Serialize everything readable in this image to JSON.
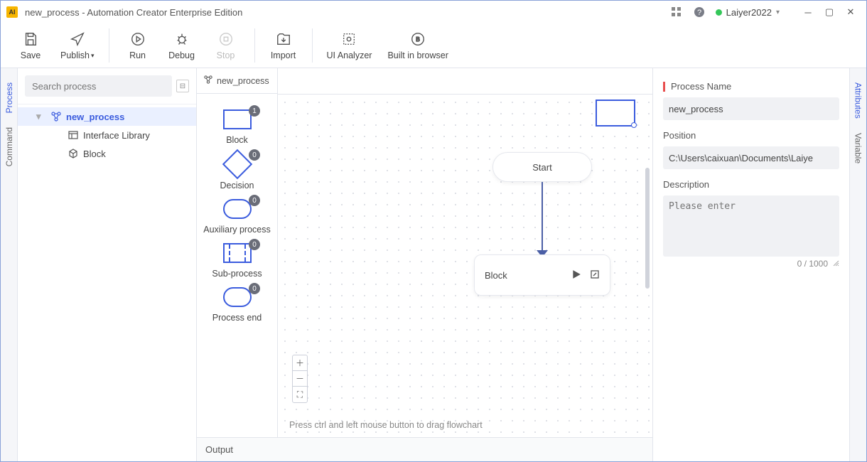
{
  "titlebar": {
    "title": "new_process - Automation Creator Enterprise Edition",
    "username": "Laiyer2022"
  },
  "toolbar": {
    "save": "Save",
    "publish": "Publish",
    "run": "Run",
    "debug": "Debug",
    "stop": "Stop",
    "import": "Import",
    "ui_analyzer": "UI Analyzer",
    "built_in_browser": "Built in browser"
  },
  "side_tabs_left": {
    "process": "Process",
    "command": "Command"
  },
  "side_tabs_right": {
    "attributes": "Attributes",
    "variable": "Variable"
  },
  "left_panel": {
    "search_placeholder": "Search process",
    "tree": {
      "root": "new_process",
      "children": [
        {
          "icon": "interface-library-icon",
          "label": "Interface Library"
        },
        {
          "icon": "block-icon",
          "label": "Block"
        }
      ]
    }
  },
  "palette": {
    "header": "new_process",
    "items": [
      {
        "label": "Block",
        "badge": "1",
        "shape": "block"
      },
      {
        "label": "Decision",
        "badge": "0",
        "shape": "decision"
      },
      {
        "label": "Auxiliary process",
        "badge": "0",
        "shape": "aux"
      },
      {
        "label": "Sub-process",
        "badge": "0",
        "shape": "sub"
      },
      {
        "label": "Process end",
        "badge": "0",
        "shape": "end"
      }
    ]
  },
  "canvas": {
    "start_label": "Start",
    "block_label": "Block",
    "hint": "Press ctrl and left mouse button to drag flowchart"
  },
  "output": {
    "label": "Output"
  },
  "props": {
    "process_name_label": "Process Name",
    "process_name_value": "new_process",
    "position_label": "Position",
    "position_value": "C:\\Users\\caixuan\\Documents\\Laiye",
    "description_label": "Description",
    "description_placeholder": "Please enter",
    "char_count": "0 / 1000"
  }
}
